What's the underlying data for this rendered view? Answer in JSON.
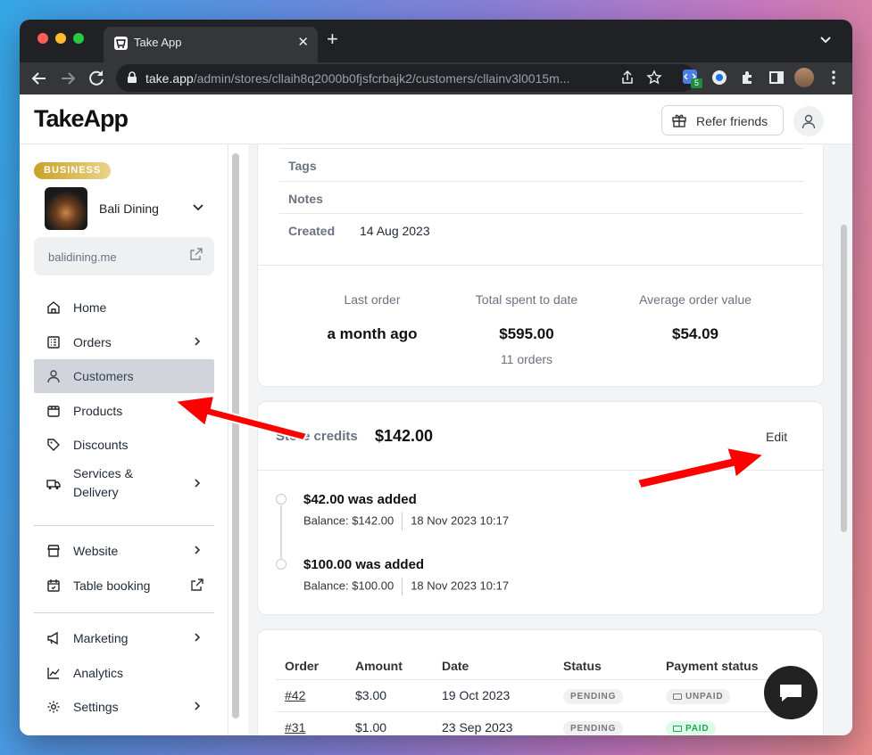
{
  "browser": {
    "tab_title": "Take App",
    "url_host": "take.app",
    "url_path": "/admin/stores/cllaih8q2000b0fjsfcrbajk2/customers/cllainv3l0015m...",
    "extension_badge": "5"
  },
  "header": {
    "logo": "TakeApp",
    "refer_label": "Refer friends"
  },
  "sidebar": {
    "plan_badge": "BUSINESS",
    "store_name": "Bali Dining",
    "store_link": "balidining.me",
    "items": [
      {
        "label": "Home",
        "icon": "home-icon"
      },
      {
        "label": "Orders",
        "icon": "orders-icon"
      },
      {
        "label": "Customers",
        "icon": "user-icon"
      },
      {
        "label": "Products",
        "icon": "box-icon"
      },
      {
        "label": "Discounts",
        "icon": "tag-icon"
      },
      {
        "label": "Services & Delivery",
        "icon": "truck-icon"
      },
      {
        "label": "Website",
        "icon": "store-icon"
      },
      {
        "label": "Table booking",
        "icon": "calendar-icon"
      },
      {
        "label": "Marketing",
        "icon": "megaphone-icon"
      },
      {
        "label": "Analytics",
        "icon": "chart-icon"
      },
      {
        "label": "Settings",
        "icon": "gear-icon"
      }
    ]
  },
  "customer": {
    "tags_label": "Tags",
    "notes_label": "Notes",
    "created_label": "Created",
    "created_value": "14 Aug 2023",
    "stats": {
      "last_order_label": "Last order",
      "last_order_value": "a month ago",
      "total_label": "Total spent to date",
      "total_value": "$595.00",
      "total_sub": "11 orders",
      "avg_label": "Average order value",
      "avg_value": "$54.09"
    }
  },
  "credits": {
    "label": "Store credits",
    "value": "$142.00",
    "edit_label": "Edit",
    "history": [
      {
        "title": "$42.00 was added",
        "balance": "Balance: $142.00",
        "date": "18 Nov 2023 10:17"
      },
      {
        "title": "$100.00 was added",
        "balance": "Balance: $100.00",
        "date": "18 Nov 2023 10:17"
      }
    ]
  },
  "orders": {
    "columns": [
      "Order",
      "Amount",
      "Date",
      "Status",
      "Payment status"
    ],
    "rows": [
      {
        "order": "#42",
        "amount": "$3.00",
        "date": "19 Oct 2023",
        "status": "PENDING",
        "payment": "UNPAID"
      },
      {
        "order": "#31",
        "amount": "$1.00",
        "date": "23 Sep 2023",
        "status": "PENDING",
        "payment": "PAID"
      }
    ]
  },
  "colors": {
    "accent_red": "#ff0000",
    "paid_green": "#22a35a",
    "badge_gold": "#c9a227"
  }
}
